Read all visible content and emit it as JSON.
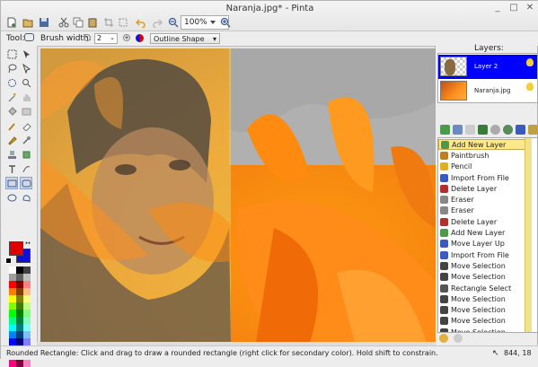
{
  "window": {
    "title": "Naranja.jpg* - Pinta"
  },
  "toolbar": {
    "zoom_value": "100%",
    "tool_label": "Tool:",
    "brush_width_label": "Brush width:",
    "brush_width_value": "2",
    "shape_type": "Outline Shape"
  },
  "colors": {
    "primary": "#e00000",
    "secondary": "#1010d8",
    "selection": "#0000ff",
    "history_highlight": "#ffe98a"
  },
  "layers": {
    "title": "Layers:",
    "items": [
      {
        "name": "Layer 2",
        "selected": true
      },
      {
        "name": "Naranja.jpg",
        "selected": false
      }
    ]
  },
  "history": {
    "items": [
      {
        "label": "Add New Layer",
        "icon": "add-layer-icon",
        "selected": true
      },
      {
        "label": "Paintbrush",
        "icon": "paintbrush-icon"
      },
      {
        "label": "Pencil",
        "icon": "pencil-icon"
      },
      {
        "label": "Import From File",
        "icon": "import-icon"
      },
      {
        "label": "Delete Layer",
        "icon": "delete-layer-icon"
      },
      {
        "label": "Eraser",
        "icon": "eraser-icon"
      },
      {
        "label": "Eraser",
        "icon": "eraser-icon"
      },
      {
        "label": "Delete Layer",
        "icon": "delete-layer-icon"
      },
      {
        "label": "Add New Layer",
        "icon": "add-layer-icon"
      },
      {
        "label": "Move Layer Up",
        "icon": "move-up-icon"
      },
      {
        "label": "Import From File",
        "icon": "import-icon"
      },
      {
        "label": "Move Selection",
        "icon": "move-selection-icon"
      },
      {
        "label": "Move Selection",
        "icon": "move-selection-icon"
      },
      {
        "label": "Rectangle Select",
        "icon": "rect-select-icon"
      },
      {
        "label": "Move Selection",
        "icon": "move-selection-icon"
      },
      {
        "label": "Move Selection",
        "icon": "move-selection-icon"
      },
      {
        "label": "Move Selection",
        "icon": "move-selection-icon"
      },
      {
        "label": "Move Selection",
        "icon": "move-selection-icon"
      }
    ]
  },
  "status": {
    "hint": "Rounded Rectangle: Click and drag to draw a rounded rectangle (right click for secondary color). Hold shift to constrain.",
    "coordinates": "844, 18"
  }
}
